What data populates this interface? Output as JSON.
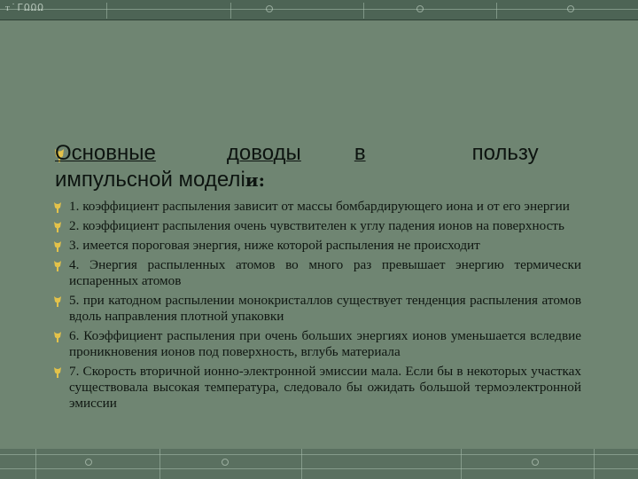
{
  "topbar": {
    "glyphs": "ᴛ˙ΓΩΩΩ"
  },
  "heading": {
    "words": [
      "Основные",
      "доводы",
      "в",
      "пользу",
      "импульсной моделі",
      "и:"
    ]
  },
  "points": [
    "1. коэффициент распыления зависит от массы бомбардирующего иона и от его энергии",
    "2. коэффициент распыления очень чувствителен к углу падения ионов на поверхность",
    "3. имеется пороговая энергия, ниже которой распыления не происходит",
    "4. Энергия распыленных атомов во много раз превышает энергию термически испаренных атомов",
    "5. при катодном распылении монокристаллов существует тенденция распыления атомов вдоль направления плотной упаковки",
    "6. Коэффициент распыления при очень больших энергиях ионов уменьшается вследвие проникновения ионов под поверхность, вглубь материала",
    "7. Скорость вторичной ионно-электронной эмиссии мала. Если бы в некоторых участках существовала высокая температура, следовало бы ожидать большой термоэлектронной эмиссии"
  ],
  "colors": {
    "background": "#6f8572",
    "bullet": "#e3c24a",
    "text": "#0f1611"
  },
  "icons": {
    "bullet": "tulip-bullet-icon"
  }
}
